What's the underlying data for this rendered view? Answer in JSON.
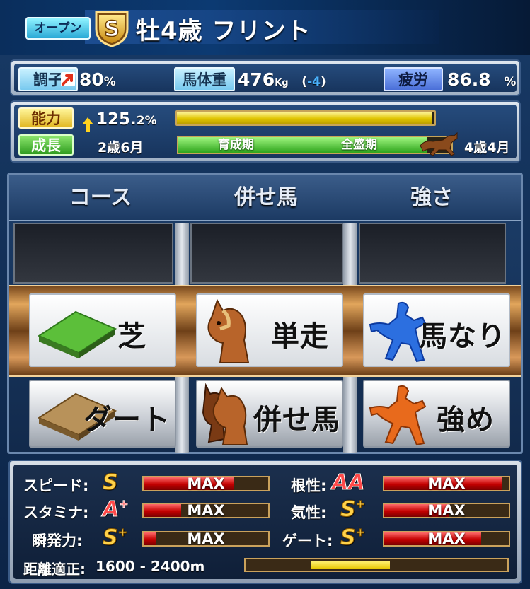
{
  "header": {
    "class_badge": "オープン",
    "grade_badge": "S",
    "horse_title": "牡4歳 フリント"
  },
  "condition": {
    "form_label": "調子",
    "form_value": "80",
    "form_unit": "%",
    "weight_label": "馬体重",
    "weight_value": "476",
    "weight_unit": "Kg",
    "weight_change_open": "(",
    "weight_change": "-4",
    "weight_change_close": ")",
    "fatigue_label": "疲労",
    "fatigue_value": "86.8",
    "fatigue_unit": "%"
  },
  "ability": {
    "ability_label": "能力",
    "ability_value": "125.",
    "ability_value_small": "2%",
    "ability_fill_fraction": 0.99,
    "growth_label": "成長",
    "growth_start": "2歳6月",
    "growth_phase1": "育成期",
    "growth_phase2": "全盛期",
    "growth_end": "4歳4月",
    "growth_fill_fraction": 0.91
  },
  "training": {
    "columns": [
      "コース",
      "併せ馬",
      "強さ"
    ],
    "row1": [
      "芝",
      "単走",
      "馬なり"
    ],
    "row2": [
      "ダート",
      "併せ馬",
      "強め"
    ]
  },
  "stats": {
    "left": [
      {
        "label": "スピード:",
        "grade": "S",
        "plus": "",
        "bar_text": "MAX",
        "fill": 0.72
      },
      {
        "label": "スタミナ:",
        "grade": "A",
        "plus": "+",
        "bar_text": "MAX",
        "fill": 0.3
      },
      {
        "label": "瞬発力:",
        "grade": "S",
        "plus": "+",
        "bar_text": "MAX",
        "fill": 0.1
      }
    ],
    "right": [
      {
        "label": "根性:",
        "grade": "AA",
        "plus": "",
        "bar_text": "MAX",
        "fill": 0.95
      },
      {
        "label": "気性:",
        "grade": "S",
        "plus": "+",
        "bar_text": "MAX",
        "fill": 0.52
      },
      {
        "label": "ゲート:",
        "grade": "S",
        "plus": "+",
        "bar_text": "MAX",
        "fill": 0.78
      }
    ],
    "distance_label": "距離適正:",
    "distance_value": "1600 - 2400m",
    "distance_fill_start": 0.25,
    "distance_fill_end": 0.55
  },
  "colors": {
    "accent_gold": "#e0c500",
    "stat_bar_red": "#c40000",
    "growth_green": "#2fa51d"
  }
}
